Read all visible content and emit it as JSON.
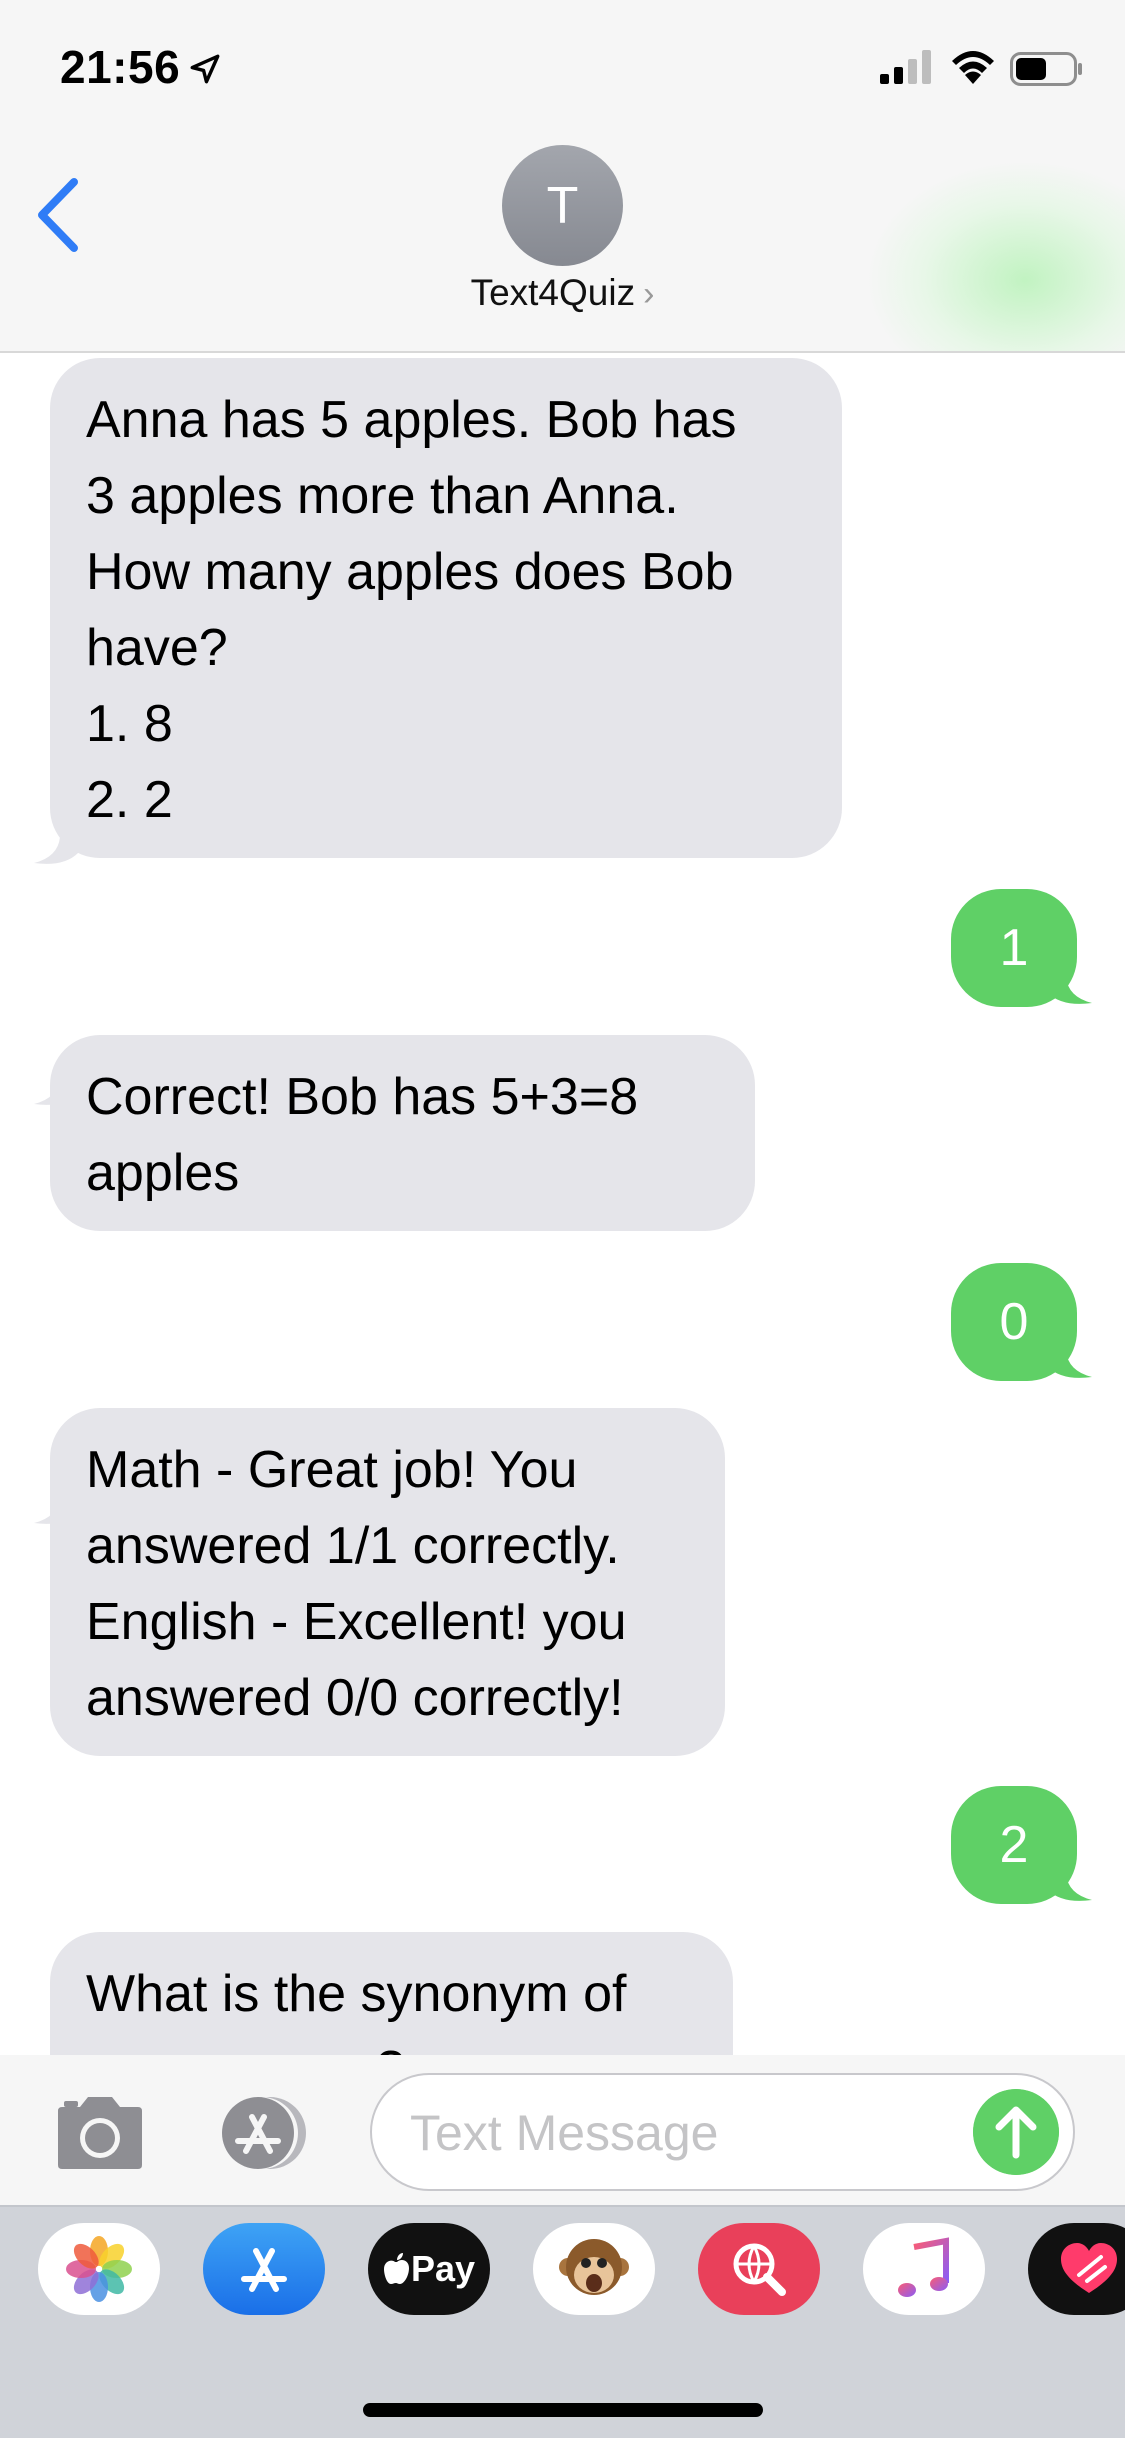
{
  "status": {
    "time": "21:56"
  },
  "header": {
    "avatar_initial": "T",
    "contact_name": "Text4Quiz",
    "chevron": "›"
  },
  "messages": [
    {
      "direction": "incoming",
      "lines": [
        "Anna has 5 apples. Bob has",
        "3 apples more than Anna.",
        "How many apples does Bob",
        "have?",
        "1. 8",
        "2. 2"
      ]
    },
    {
      "direction": "outgoing",
      "lines": [
        "1"
      ]
    },
    {
      "direction": "incoming",
      "lines": [
        "Correct! Bob has 5+3=8",
        "apples"
      ]
    },
    {
      "direction": "outgoing",
      "lines": [
        "0"
      ]
    },
    {
      "direction": "incoming",
      "lines": [
        "Math - Great job! You",
        "answered 1/1 correctly.",
        "English - Excellent! you",
        "answered 0/0 correctly!"
      ]
    },
    {
      "direction": "outgoing",
      "lines": [
        "2"
      ]
    },
    {
      "direction": "incoming",
      "lines": [
        "What is the synonym of",
        "?"
      ]
    }
  ],
  "input": {
    "placeholder": "Text Message"
  },
  "app_drawer": {
    "apple_pay_label": "Pay",
    "apps": [
      "photos-icon",
      "app-store-icon",
      "apple-pay-icon",
      "animoji-icon",
      "web-search-icon",
      "music-icon",
      "digital-touch-icon"
    ]
  },
  "colors": {
    "accent_blue": "#2f7cf6",
    "outgoing_bubble": "#5fd066",
    "incoming_bubble": "#e5e5ea"
  }
}
